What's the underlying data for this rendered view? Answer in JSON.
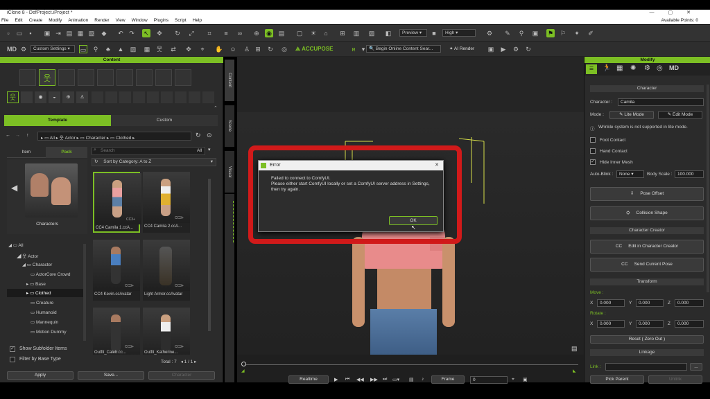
{
  "window": {
    "title": "iClone 8 - DefProject.iProject *",
    "controls": [
      "—",
      "▢",
      "✕"
    ]
  },
  "menu": {
    "items": [
      "File",
      "Edit",
      "Create",
      "Modify",
      "Animation",
      "Render",
      "View",
      "Window",
      "Plugins",
      "Script",
      "Help"
    ],
    "points": "Available Points: 0"
  },
  "toolbar": {
    "preview_label": "Preview",
    "quality_label": "High",
    "custom_settings": "Custom Settings",
    "accupose": "ACCUPOSE",
    "search_placeholder": "Begin Online Content Sear...",
    "ai_render": "AI Render"
  },
  "content": {
    "title": "Content",
    "tab_template": "Template",
    "tab_custom": "Custom",
    "breadcrumb": [
      "All",
      "Actor",
      "Character",
      "Clothed"
    ],
    "tab_item": "Item",
    "tab_pack": "Pack",
    "search_placeholder": "Search",
    "search_scope": "All",
    "sort_label": "Sort by Category: A to Z",
    "pack_caption": "Characters",
    "tree": [
      "All",
      "Actor",
      "Character",
      "ActorCore Crowd",
      "Base",
      "Clothed",
      "Creature",
      "Humanoid",
      "Mannequin",
      "Motion Dummy"
    ],
    "items": [
      "CC4 Camila 1.ccA...",
      "CC4 Camila 2.ccA...",
      "CC4 Kevin.ccAvatar",
      "Light Armor.ccAvatar",
      "Outfit_Caleb.cc...",
      "Outfit_Katherine..."
    ],
    "badge": "CC3+",
    "show_subfolder": "Show Subfolder Items",
    "filter_base": "Filter by Base Type",
    "total_label": "Total : 7",
    "page_current": "1",
    "page_sep": "/",
    "page_total": "1",
    "apply": "Apply",
    "save": "Save...",
    "character": "Character"
  },
  "side_tabs": [
    "Content",
    "Scene",
    "Visual"
  ],
  "dialog": {
    "title": "Error",
    "message_1": "Failed to connect to ComfyUI.",
    "message_2": "Please either start ComfyUI locally or set a ComfyUI server address in Settings,",
    "message_3": "then try again.",
    "ok": "OK",
    "close": "✕"
  },
  "timeline": {
    "realtime": "Realtime",
    "frame_label": "Frame",
    "frame_value": "0"
  },
  "modify": {
    "title": "Modify",
    "section_character": "Character",
    "character_label": "Character :",
    "character_value": "Camila",
    "mode_label": "Mode :",
    "lite_mode": "Lite Mode",
    "edit_mode": "Edit Mode",
    "wrinkle_note": "Wrinkle system is not supported in lite mode.",
    "foot_contact": "Foot Contact",
    "hand_contact": "Hand Contact",
    "hide_inner_mesh": "Hide Inner Mesh",
    "auto_blink_label": "Auto-Blink :",
    "auto_blink_value": "None",
    "body_scale_label": "Body Scale :",
    "body_scale_value": "100.000",
    "pose_offset": "Pose Offset",
    "collision_shape": "Collision Shape",
    "section_creator": "Character Creator",
    "edit_in_cc": "Edit in Character Creator",
    "send_pose": "Send Current Pose",
    "section_transform": "Transform",
    "move_label": "Move :",
    "rotate_label": "Rotate :",
    "axis_x": "X",
    "axis_y": "Y",
    "axis_z": "Z",
    "move_x": "0.000",
    "move_y": "0.000",
    "move_z": "0.000",
    "rot_x": "0.000",
    "rot_y": "0.000",
    "rot_z": "0.000",
    "reset": "Reset ( Zero Out )",
    "section_linkage": "Linkage",
    "link_label": "Link :",
    "link_more": "...",
    "pick_parent": "Pick Parent",
    "unlink": "Unlink"
  },
  "colors": {
    "accent": "#7cbf24",
    "highlight_box": "#d11a1a",
    "panel": "#2b2b2b"
  }
}
